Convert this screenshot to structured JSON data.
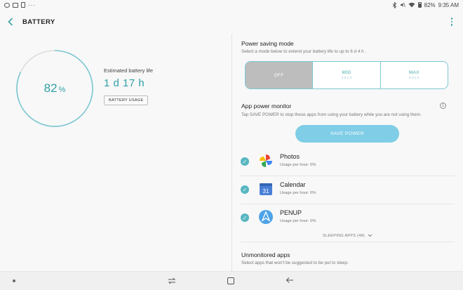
{
  "status_bar": {
    "battery_percent": "82%",
    "time": "9:35 AM",
    "overflow": "···"
  },
  "header": {
    "title": "BATTERY",
    "back_icon": "chevron-left-icon",
    "more_icon": "more-vertical-icon"
  },
  "battery": {
    "level_value": "82",
    "level_unit": "%",
    "level_fraction": 0.82,
    "estimated_label": "Estimated battery life",
    "estimated_value": "1 d 17 h",
    "usage_button": "BATTERY USAGE",
    "accent_color": "#2e9fa6"
  },
  "power_saving": {
    "title": "Power saving mode",
    "subtitle": "Select a mode below to extend your battery life to up to 6 d 4 h .",
    "modes": [
      {
        "label": "OFF",
        "sub": "",
        "selected": true
      },
      {
        "label": "MID",
        "sub": "2 d 1 h",
        "selected": false
      },
      {
        "label": "MAX",
        "sub": "6 d 4 h",
        "selected": false
      }
    ]
  },
  "app_monitor": {
    "title": "App power monitor",
    "subtitle": "Tap SAVE POWER to stop these apps from using your battery while you are not using them.",
    "info_icon": "i",
    "save_button": "SAVE POWER",
    "save_button_color": "#7fcde6",
    "apps": [
      {
        "name": "Photos",
        "usage": "Usage per hour: 0%",
        "icon": "photos-pinwheel-icon",
        "checked": true
      },
      {
        "name": "Calendar",
        "usage": "Usage per hour: 0%",
        "icon": "calendar-icon",
        "icon_text": "31",
        "checked": true
      },
      {
        "name": "PENUP",
        "usage": "Usage per hour: 0%",
        "icon": "penup-icon",
        "checked": true
      }
    ],
    "sleeping_apps": "SLEEPING APPS (48)"
  },
  "unmonitored": {
    "title": "Unmonitored apps",
    "subtitle": "Select apps that won't be suggested to be put to sleep."
  },
  "nav_bar": {
    "recents_icon": "recents-icon",
    "home_icon": "home-icon",
    "back_icon": "back-arrow-icon"
  }
}
